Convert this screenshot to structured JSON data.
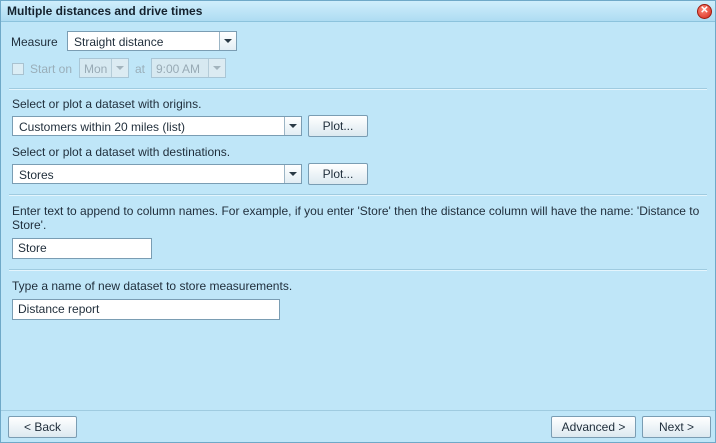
{
  "window": {
    "title": "Multiple distances and drive times"
  },
  "measure": {
    "label": "Measure",
    "selected": "Straight distance"
  },
  "start": {
    "checkbox_label": "Start on",
    "day": "Mon",
    "at_label": "at",
    "time": "9:00 AM"
  },
  "origins": {
    "prompt": "Select or plot a dataset with origins.",
    "selected": "Customers within 20 miles (list)",
    "plot_label": "Plot..."
  },
  "destinations": {
    "prompt": "Select or plot a dataset with destinations.",
    "selected": "Stores",
    "plot_label": "Plot..."
  },
  "append": {
    "prompt": "Enter text to append to column names. For example, if you enter 'Store' then the distance column will have the name: 'Distance to Store'.",
    "value": "Store"
  },
  "dataset_name": {
    "prompt": "Type a name of new dataset to store measurements.",
    "value": "Distance report"
  },
  "footer": {
    "back_label": "< Back",
    "advanced_label": "Advanced >",
    "next_label": "Next >"
  },
  "icons": {
    "close": "close-icon"
  }
}
